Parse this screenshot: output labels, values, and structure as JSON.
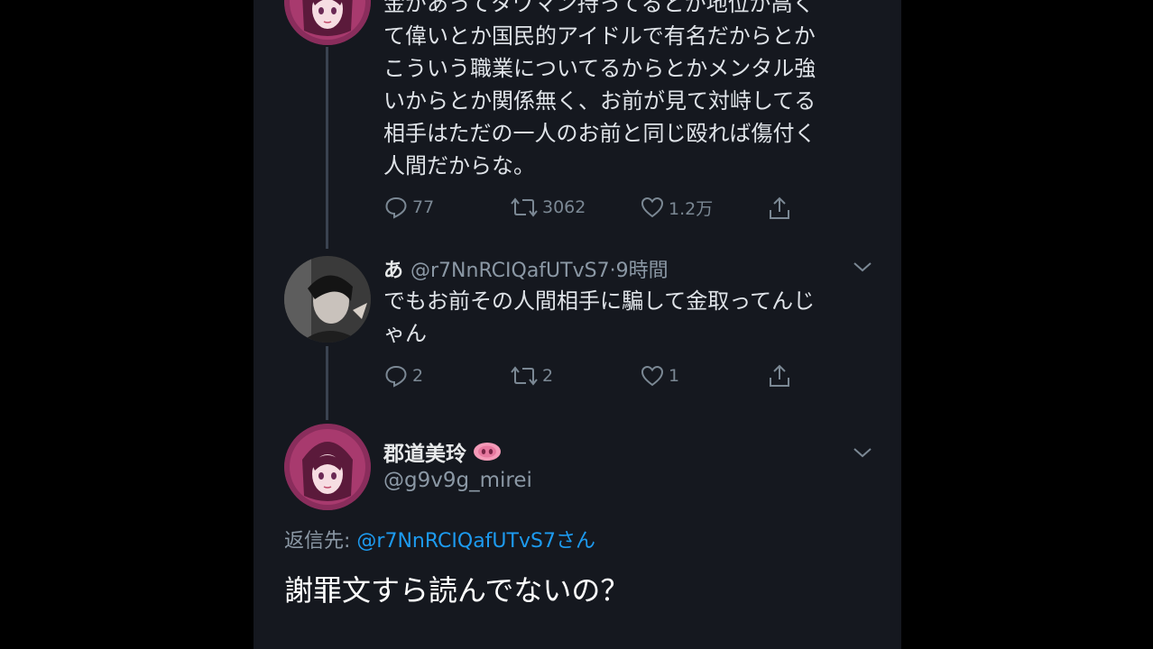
{
  "colors": {
    "background": "#15181f",
    "outer_background": "#000000",
    "text": "#e7e9ea",
    "muted": "#8b98a5",
    "mention": "#1d9bf0",
    "thread_line": "#3a4350"
  },
  "tweet1": {
    "text": "金があってタワマン持ってるとか地位が高く\nて偉いとか国民的アイドルで有名だからとか\nこういう職業についてるからとかメンタル強\nいからとか関係無く、お前が見て対峙してる\n相手はただの一人のお前と同じ殴れば傷付く\n人間だからな。",
    "replies": "77",
    "retweets": "3062",
    "likes": "1.2万",
    "avatar_icon": "avatar-anime-girl"
  },
  "tweet2": {
    "name": "あ",
    "handle": "@r7NnRCIQafUTvS7",
    "time": "·9時間",
    "text": "でもお前その人間相手に騙して金取ってんじ\nゃん",
    "replies": "2",
    "retweets": "2",
    "likes": "1",
    "avatar_icon": "avatar-photo"
  },
  "main_tweet": {
    "name": "郡道美玲",
    "name_emoji_icon": "pig-nose-icon",
    "handle": "@g9v9g_mirei",
    "replying_to_label": "返信先: ",
    "replying_to_mention": "@r7NnRCIQafUTvS7さん",
    "text": "謝罪文すら読んでないの？",
    "avatar_icon": "avatar-anime-girl"
  }
}
